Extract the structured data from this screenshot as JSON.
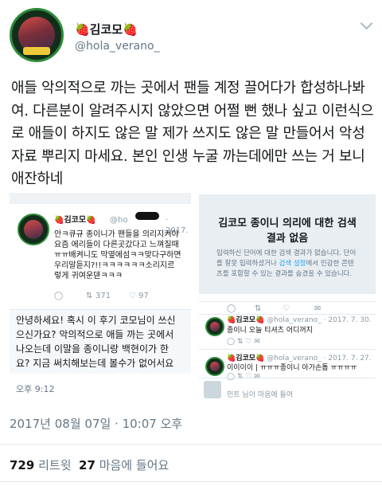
{
  "header": {
    "display_name": "🍓김코모🍓",
    "handle": "@hola_verano_"
  },
  "tweet": {
    "text": "애들 악의적으로 까는 곳에서 팬들 계정 끌어다가 합성하나봐여. 다른분이 알려주시지 않았으면 어쩔 뻔 했나 싶고 이런식으로 애들이 하지도 않은 말 제가 쓰지도 않은 말 만들어서 악성 자료 뿌리지 마세요. 본인 인생 누굴 까는데에만 쓰는 거 보니 애잔하네",
    "timestamp": "2017년 08월 07일 · 10:07 오후",
    "retweet_count": "729",
    "retweet_label": "리트윗",
    "like_count": "27",
    "like_label": "마음에 들어요"
  },
  "left_image": {
    "name": "🍓김코모🍓",
    "handle": "@ho",
    "date": "· 2017.",
    "lines": [
      "안ㅋ큐규 종이니가 팬들을 의리지켜야",
      "요즘 에리들이 다른곳갔다고 느껴질때",
      "ㅠㅠ배켜니도 막옆에섬ㅋㅋ맞다구하면",
      "우리말듣지?!!ㅋㅋㅋㅋㅋㅋ소리지르",
      "렇게 귀여운덷ㅋㅋㅋ"
    ],
    "retweets": "371",
    "likes": "97",
    "quote_lines": [
      "안녕하세요! 혹시 이 후기 코모님이 쓰신",
      "으신가요? 악의적으로 애들 까는 곳에서",
      "나오는데 이말을 종이니랑 백현이가 한",
      "요? 지금 써치해보는데 볼수가 없어서요"
    ],
    "quote_time": "오후 9:12"
  },
  "right_image": {
    "search_title": "김코모 종이니 의리에 대한 검색 결과 없음",
    "search_desc_1": "입력하신 단어에 대한 검색 결과가 없습니다. 단어를 잘못 입력하셨거나 ",
    "search_link": "검색 설정",
    "search_desc_2": "에서 민감한 콘텐츠를 포함할 수 있는 결과를 숨겼을 수 있습니다.",
    "rows": [
      {
        "name": "🍓김코모🍓",
        "handle": "@hola_verano_",
        "date": "· 2017. 7. 30.",
        "text": "종이니 오늘 티셔츠 어디꺼지"
      },
      {
        "name": "🍓김코모🍓",
        "handle": "@hola_verano_",
        "date": "· 2017. 7. 27.",
        "text": "이이이이 | ㅠㅠㅠ종이니 아가손톱 ㅠㅠㅠㅠ"
      }
    ],
    "bottom_text": "민트 님이 마음에 들어"
  }
}
